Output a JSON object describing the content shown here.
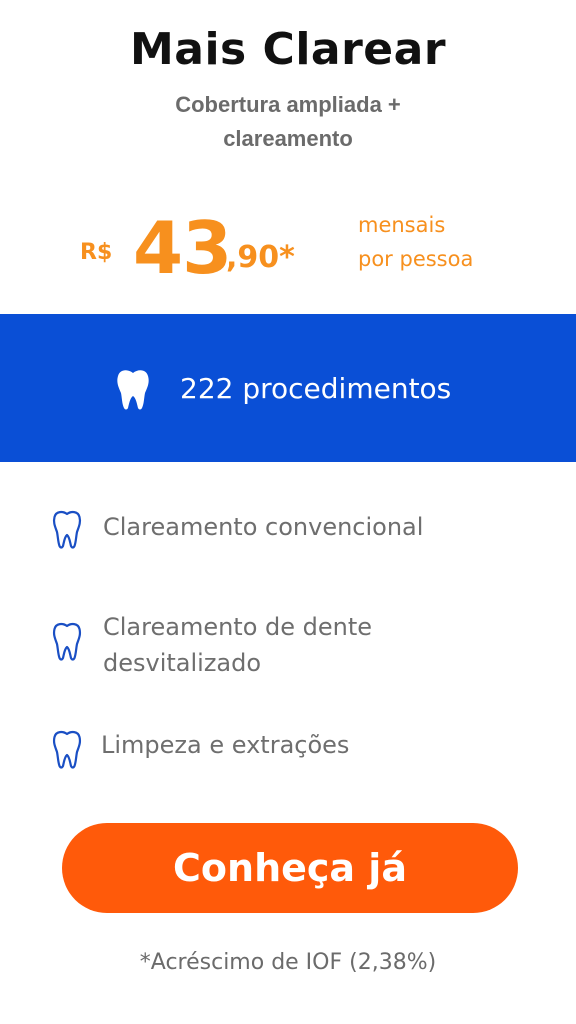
{
  "plan": {
    "title": "Mais Clarear",
    "subtitle_line1": "Cobertura ampliada +",
    "subtitle_line2": "clareamento"
  },
  "price": {
    "currency": "R$",
    "amount": "43",
    "cents": ",90*",
    "period_line1": "mensais",
    "period_line2": "por pessoa"
  },
  "banner": {
    "icon": "tooth-icon",
    "text": "222 procedimentos"
  },
  "features": [
    {
      "icon": "tooth-outline-icon",
      "line1": "Clareamento convencional",
      "line2": ""
    },
    {
      "icon": "tooth-outline-icon",
      "line1": "Clareamento de dente",
      "line2": "desvitalizado"
    },
    {
      "icon": "tooth-outline-icon",
      "line1": "Limpeza e extrações",
      "line2": ""
    }
  ],
  "cta": {
    "label": "Conheça já"
  },
  "footnote": "*Acréscimo de IOF (2,38%)",
  "colors": {
    "accent_orange": "#f7901e",
    "cta_orange": "#ff5a0a",
    "banner_blue": "#0a4fd6",
    "icon_blue": "#1a4fc4"
  }
}
